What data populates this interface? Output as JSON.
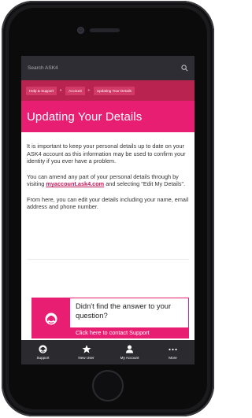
{
  "search": {
    "placeholder": "Search ASK4"
  },
  "breadcrumb": [
    "Help & Support",
    "Account",
    "Updating Your Details"
  ],
  "page": {
    "title": "Updating Your Details"
  },
  "body": {
    "p1": "It is important to keep your personal details up to date on your ASK4 account as this information may be used to confirm your identity if you ever have a problem.",
    "p2_before": "You can amend any part of your personal details through by visiting ",
    "p2_link": "myaccount.ask4.com",
    "p2_after": " and selecting \"Edit My Details\".",
    "p3": "From here, you can edit your details including your name, email address and phone number."
  },
  "support_card": {
    "question": "Didn't find the answer to your question?",
    "link": "Click here to contact Support"
  },
  "tabbar": [
    {
      "label": "Support",
      "icon": "support-icon"
    },
    {
      "label": "New User",
      "icon": "star-icon"
    },
    {
      "label": "My Account",
      "icon": "user-icon"
    },
    {
      "label": "More",
      "icon": "more-dots-icon"
    }
  ],
  "colors": {
    "accent": "#e81e73",
    "breadcrumb_bg": "#b8234f",
    "search_bg": "#2d2d33",
    "tabbar_bg": "#2a2a2f"
  }
}
